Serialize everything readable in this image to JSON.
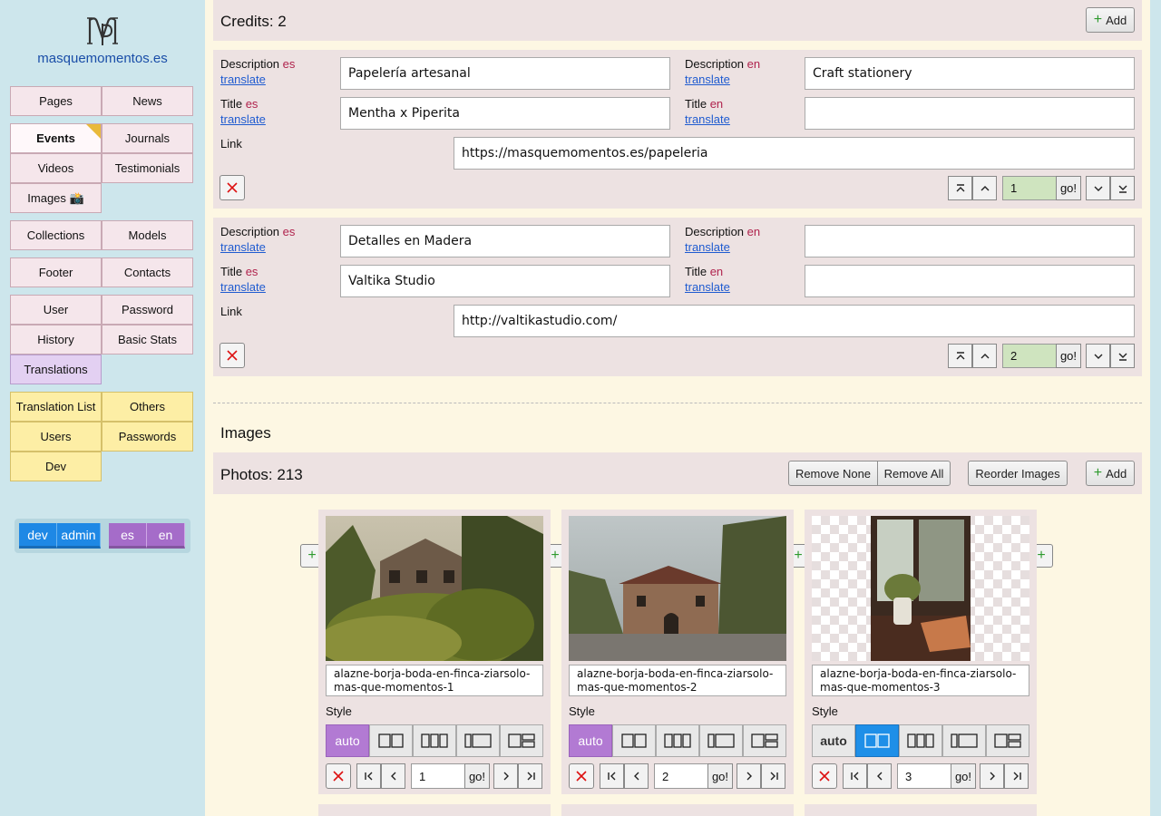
{
  "site": {
    "name": "masquemomentos.es"
  },
  "nav": {
    "pages": "Pages",
    "news": "News",
    "events": "Events",
    "journals": "Journals",
    "videos": "Videos",
    "testimonials": "Testimonials",
    "images": "Images 📸",
    "collections": "Collections",
    "models": "Models",
    "footer": "Footer",
    "contacts": "Contacts",
    "user": "User",
    "password": "Password",
    "history": "History",
    "basic_stats": "Basic Stats",
    "translations": "Translations",
    "translation_list": "Translation List",
    "others": "Others",
    "users": "Users",
    "passwords": "Passwords",
    "dev": "Dev"
  },
  "toggles": {
    "dev": "dev",
    "admin": "admin",
    "es": "es",
    "en": "en"
  },
  "colors": {
    "accent_blue": "#1e88e5",
    "accent_purple": "#a56cc9",
    "sidebar_bg": "#cde6ec",
    "main_bg": "#fdf7e3"
  },
  "credits": {
    "title": "Credits: 2",
    "add_label": "Add",
    "labels": {
      "description": "Description",
      "title": "Title",
      "link": "Link",
      "es": "es",
      "en": "en",
      "translate": "translate",
      "go": "go!"
    },
    "items": [
      {
        "desc_es": "Papelería artesanal",
        "desc_en": "Craft stationery",
        "title_es": "Mentha x Piperita",
        "title_en": "",
        "link": "https://masquemomentos.es/papeleria",
        "position": "1"
      },
      {
        "desc_es": "Detalles en Madera",
        "desc_en": "",
        "title_es": "Valtika Studio",
        "title_en": "",
        "link": "http://valtikastudio.com/",
        "position": "2"
      }
    ]
  },
  "images": {
    "section_title": "Images",
    "photos_title": "Photos: 213",
    "remove_none": "Remove None",
    "remove_all": "Remove All",
    "reorder": "Reorder Images",
    "add_label": "Add",
    "style_label": "Style",
    "auto_label": "auto",
    "go": "go!",
    "photos": [
      {
        "caption": "alazne-borja-boda-en-finca-ziarsolo-mas-que-momentos-1",
        "position": "1",
        "style": "auto"
      },
      {
        "caption": "alazne-borja-boda-en-finca-ziarsolo-mas-que-momentos-2",
        "position": "2",
        "style": "auto"
      },
      {
        "caption": "alazne-borja-boda-en-finca-ziarsolo-mas-que-momentos-3",
        "position": "3",
        "style": "two-column"
      }
    ]
  }
}
